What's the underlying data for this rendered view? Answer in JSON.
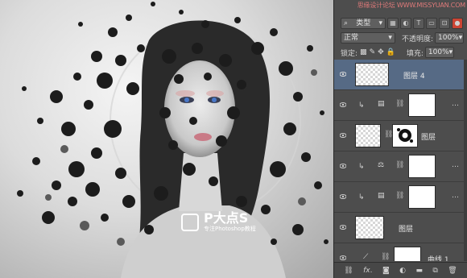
{
  "watermark_top": "思缘设计论坛 WWW.MISSYUAN.COM",
  "panel": {
    "kind_filter": "类型",
    "blend_mode": "正常",
    "opacity_label": "不透明度:",
    "opacity_value": "100%",
    "lock_label": "锁定:",
    "fill_label": "填充:",
    "fill_value": "100%",
    "layers": [
      {
        "name": "图层 4",
        "type": "pixel",
        "active": true
      },
      {
        "name": "",
        "type": "adjustment-levels",
        "clipped": true
      },
      {
        "name": "图层",
        "type": "masked-pixel"
      },
      {
        "name": "",
        "type": "adjustment-balance",
        "clipped": true
      },
      {
        "name": "",
        "type": "adjustment-levels",
        "clipped": true
      },
      {
        "name": "图层",
        "type": "pixel"
      },
      {
        "name": "曲线 1",
        "type": "adjustment-curves"
      }
    ]
  },
  "logo": {
    "title": "P大点S",
    "subtitle": "专注Photoshop教程"
  },
  "icons": [
    "link-icon",
    "fx-icon",
    "mask-add-icon",
    "adjustment-add-icon",
    "group-folder-icon",
    "new-layer-icon",
    "trash-icon"
  ],
  "colors": {
    "accent_active_layer": "#566a85",
    "panel_bg": "#4d4d4d"
  }
}
